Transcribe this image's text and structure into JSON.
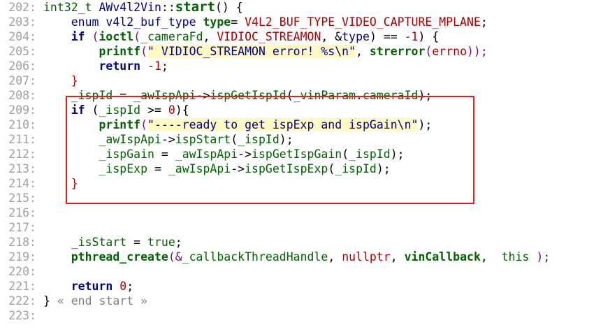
{
  "colors": {
    "background": "#ffffff",
    "line_number": "#a0a0a0",
    "type": "#006400",
    "identifier": "#00008b",
    "function": "#006400",
    "macro": "#b00000",
    "number": "#b00000",
    "string": "#00008b",
    "string_highlight": "#fff9c4",
    "operator": "#000000",
    "punctuation": "#7a0f7a",
    "comment": "#808080",
    "selection_box": "#e0201e"
  },
  "lines": [
    {
      "num": "202:",
      "tokens": [
        {
          "t": "int32_t",
          "c": "type"
        },
        {
          "t": " AWv4l2Vin",
          "c": "identifier"
        },
        {
          "t": "::",
          "c": "operator"
        },
        {
          "t": "start",
          "c": "function",
          "b": true,
          "big": true
        },
        {
          "t": "() {",
          "c": "operator"
        }
      ]
    },
    {
      "num": "203:",
      "tokens": [
        {
          "t": "    enum ",
          "c": "identifier"
        },
        {
          "t": "v4l2_buf_type",
          "c": "identifier"
        },
        {
          "t": " type",
          "c": "function",
          "b": true
        },
        {
          "t": "= ",
          "c": "operator"
        },
        {
          "t": "V4L2_BUF_TYPE_VIDEO_CAPTURE_MPLANE",
          "c": "macro"
        },
        {
          "t": ";",
          "c": "operator"
        }
      ]
    },
    {
      "num": "204:",
      "tokens": [
        {
          "t": "    if ",
          "c": "identifier",
          "b": true
        },
        {
          "t": "(",
          "c": "punctuation"
        },
        {
          "t": "ioctl",
          "c": "function",
          "b": true
        },
        {
          "t": "(",
          "c": "punctuation"
        },
        {
          "t": "_cameraFd",
          "c": "type"
        },
        {
          "t": ", ",
          "c": "operator"
        },
        {
          "t": "VIDIOC_STREAMON",
          "c": "macro"
        },
        {
          "t": ", &",
          "c": "operator"
        },
        {
          "t": "type",
          "c": "identifier"
        },
        {
          "t": ") == ",
          "c": "operator"
        },
        {
          "t": "-1",
          "c": "number"
        },
        {
          "t": ") {",
          "c": "operator"
        }
      ]
    },
    {
      "num": "205:",
      "tokens": [
        {
          "t": "        printf",
          "c": "function",
          "b": true
        },
        {
          "t": "(",
          "c": "punctuation"
        },
        {
          "t": "\" VIDIOC_STREAMON error! %s\\n\"",
          "c": "string",
          "hl": true
        },
        {
          "t": ", ",
          "c": "operator"
        },
        {
          "t": "strerror",
          "c": "function",
          "b": true
        },
        {
          "t": "(",
          "c": "punctuation"
        },
        {
          "t": "errno",
          "c": "macro"
        },
        {
          "t": "));",
          "c": "punctuation"
        }
      ]
    },
    {
      "num": "206:",
      "tokens": [
        {
          "t": "        return ",
          "c": "identifier",
          "b": true
        },
        {
          "t": "-1",
          "c": "number"
        },
        {
          "t": ";",
          "c": "operator"
        }
      ]
    },
    {
      "num": "207:",
      "tokens": [
        {
          "t": "    }",
          "c": "macro"
        }
      ]
    },
    {
      "num": "208:",
      "tokens": [
        {
          "t": "    _ispId",
          "c": "type"
        },
        {
          "t": " = ",
          "c": "operator"
        },
        {
          "t": "_awIspApi",
          "c": "type"
        },
        {
          "t": "->",
          "c": "operator"
        },
        {
          "t": "ispGetIspId",
          "c": "type"
        },
        {
          "t": "(",
          "c": "operator"
        },
        {
          "t": "_vinParam",
          "c": "type"
        },
        {
          "t": ".",
          "c": "operator"
        },
        {
          "t": "cameraId",
          "c": "type"
        },
        {
          "t": ");",
          "c": "operator"
        }
      ]
    },
    {
      "num": "209:",
      "tokens": [
        {
          "t": "    if ",
          "c": "identifier",
          "b": true
        },
        {
          "t": "(",
          "c": "operator"
        },
        {
          "t": "_ispId",
          "c": "type"
        },
        {
          "t": " >= ",
          "c": "operator"
        },
        {
          "t": "0",
          "c": "number"
        },
        {
          "t": "){",
          "c": "operator"
        }
      ]
    },
    {
      "num": "210:",
      "tokens": [
        {
          "t": "        printf",
          "c": "function",
          "b": true
        },
        {
          "t": "(",
          "c": "punctuation"
        },
        {
          "t": "\"----ready to get ispExp and ispGain\\n\"",
          "c": "string",
          "hl": true
        },
        {
          "t": ");",
          "c": "operator"
        }
      ]
    },
    {
      "num": "211:",
      "tokens": [
        {
          "t": "        _awIspApi",
          "c": "type"
        },
        {
          "t": "->",
          "c": "operator"
        },
        {
          "t": "ispStart",
          "c": "type"
        },
        {
          "t": "(",
          "c": "operator"
        },
        {
          "t": "_ispId",
          "c": "type"
        },
        {
          "t": ");",
          "c": "operator"
        }
      ]
    },
    {
      "num": "212:",
      "tokens": [
        {
          "t": "        _ispGain",
          "c": "type"
        },
        {
          "t": " = ",
          "c": "operator"
        },
        {
          "t": "_awIspApi",
          "c": "type"
        },
        {
          "t": "->",
          "c": "operator"
        },
        {
          "t": "ispGetIspGain",
          "c": "type"
        },
        {
          "t": "(",
          "c": "operator"
        },
        {
          "t": "_ispId",
          "c": "type"
        },
        {
          "t": ");",
          "c": "operator"
        }
      ]
    },
    {
      "num": "213:",
      "tokens": [
        {
          "t": "        _ispExp",
          "c": "type"
        },
        {
          "t": " = ",
          "c": "operator"
        },
        {
          "t": "_awIspApi",
          "c": "type"
        },
        {
          "t": "->",
          "c": "operator"
        },
        {
          "t": "ispGetIspExp",
          "c": "type"
        },
        {
          "t": "(",
          "c": "operator"
        },
        {
          "t": "_ispId",
          "c": "type"
        },
        {
          "t": ");",
          "c": "operator"
        }
      ]
    },
    {
      "num": "214:",
      "tokens": [
        {
          "t": "    }",
          "c": "macro"
        }
      ]
    },
    {
      "num": "215:",
      "tokens": []
    },
    {
      "num": "216:",
      "tokens": []
    },
    {
      "num": "217:",
      "tokens": []
    },
    {
      "num": "218:",
      "tokens": [
        {
          "t": "    _isStart",
          "c": "type"
        },
        {
          "t": " = ",
          "c": "operator"
        },
        {
          "t": "true",
          "c": "type"
        },
        {
          "t": ";",
          "c": "operator"
        }
      ]
    },
    {
      "num": "219:",
      "tokens": [
        {
          "t": "    pthread_create",
          "c": "function",
          "b": true
        },
        {
          "t": "(&",
          "c": "punctuation"
        },
        {
          "t": "_callbackThreadHandle",
          "c": "type"
        },
        {
          "t": ", ",
          "c": "operator"
        },
        {
          "t": "nullptr",
          "c": "macro"
        },
        {
          "t": ", ",
          "c": "operator"
        },
        {
          "t": "vinCallback",
          "c": "function",
          "b": true
        },
        {
          "t": ",  ",
          "c": "operator"
        },
        {
          "t": "this",
          "c": "function"
        },
        {
          "t": " );",
          "c": "punctuation"
        }
      ]
    },
    {
      "num": "220:",
      "tokens": []
    },
    {
      "num": "221:",
      "tokens": [
        {
          "t": "    return ",
          "c": "identifier",
          "b": true
        },
        {
          "t": "0",
          "c": "number"
        },
        {
          "t": ";",
          "c": "operator"
        }
      ]
    },
    {
      "num": "222:",
      "tokens": [
        {
          "t": "} ",
          "c": "operator"
        },
        {
          "t": "« end start »",
          "c": "comment"
        }
      ]
    },
    {
      "num": "223:",
      "tokens": []
    }
  ]
}
